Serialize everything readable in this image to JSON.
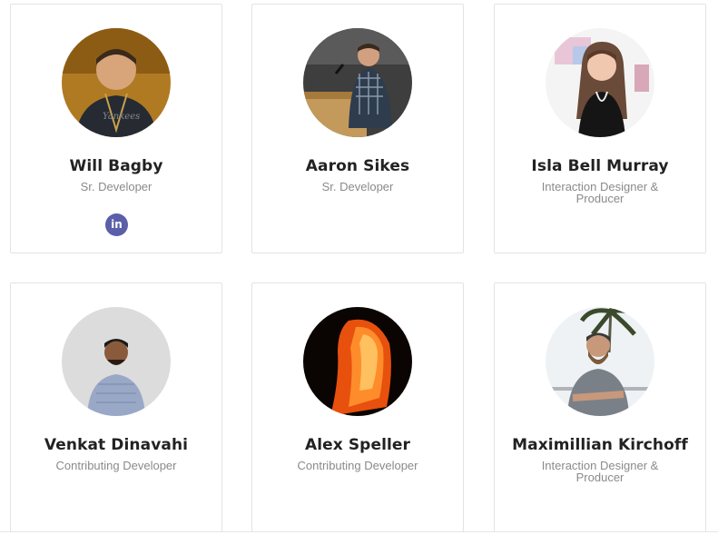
{
  "team": [
    {
      "name": "Will Bagby",
      "role": "Sr. Developer",
      "social": {
        "icon": "linkedin-icon",
        "label": "in"
      }
    },
    {
      "name": "Aaron Sikes",
      "role": "Sr. Developer"
    },
    {
      "name": "Isla Bell Murray",
      "role": "Interaction Designer & Producer"
    },
    {
      "name": "Venkat Dinavahi",
      "role": "Contributing Developer"
    },
    {
      "name": "Alex Speller",
      "role": "Contributing Developer"
    },
    {
      "name": "Maximillian Kirchoff",
      "role": "Interaction Designer & Producer"
    }
  ],
  "colors": {
    "linkedin": "#5b5ea8",
    "name_text": "#222222",
    "role_text": "#8a8a8a",
    "card_border": "#e3e3e3"
  }
}
